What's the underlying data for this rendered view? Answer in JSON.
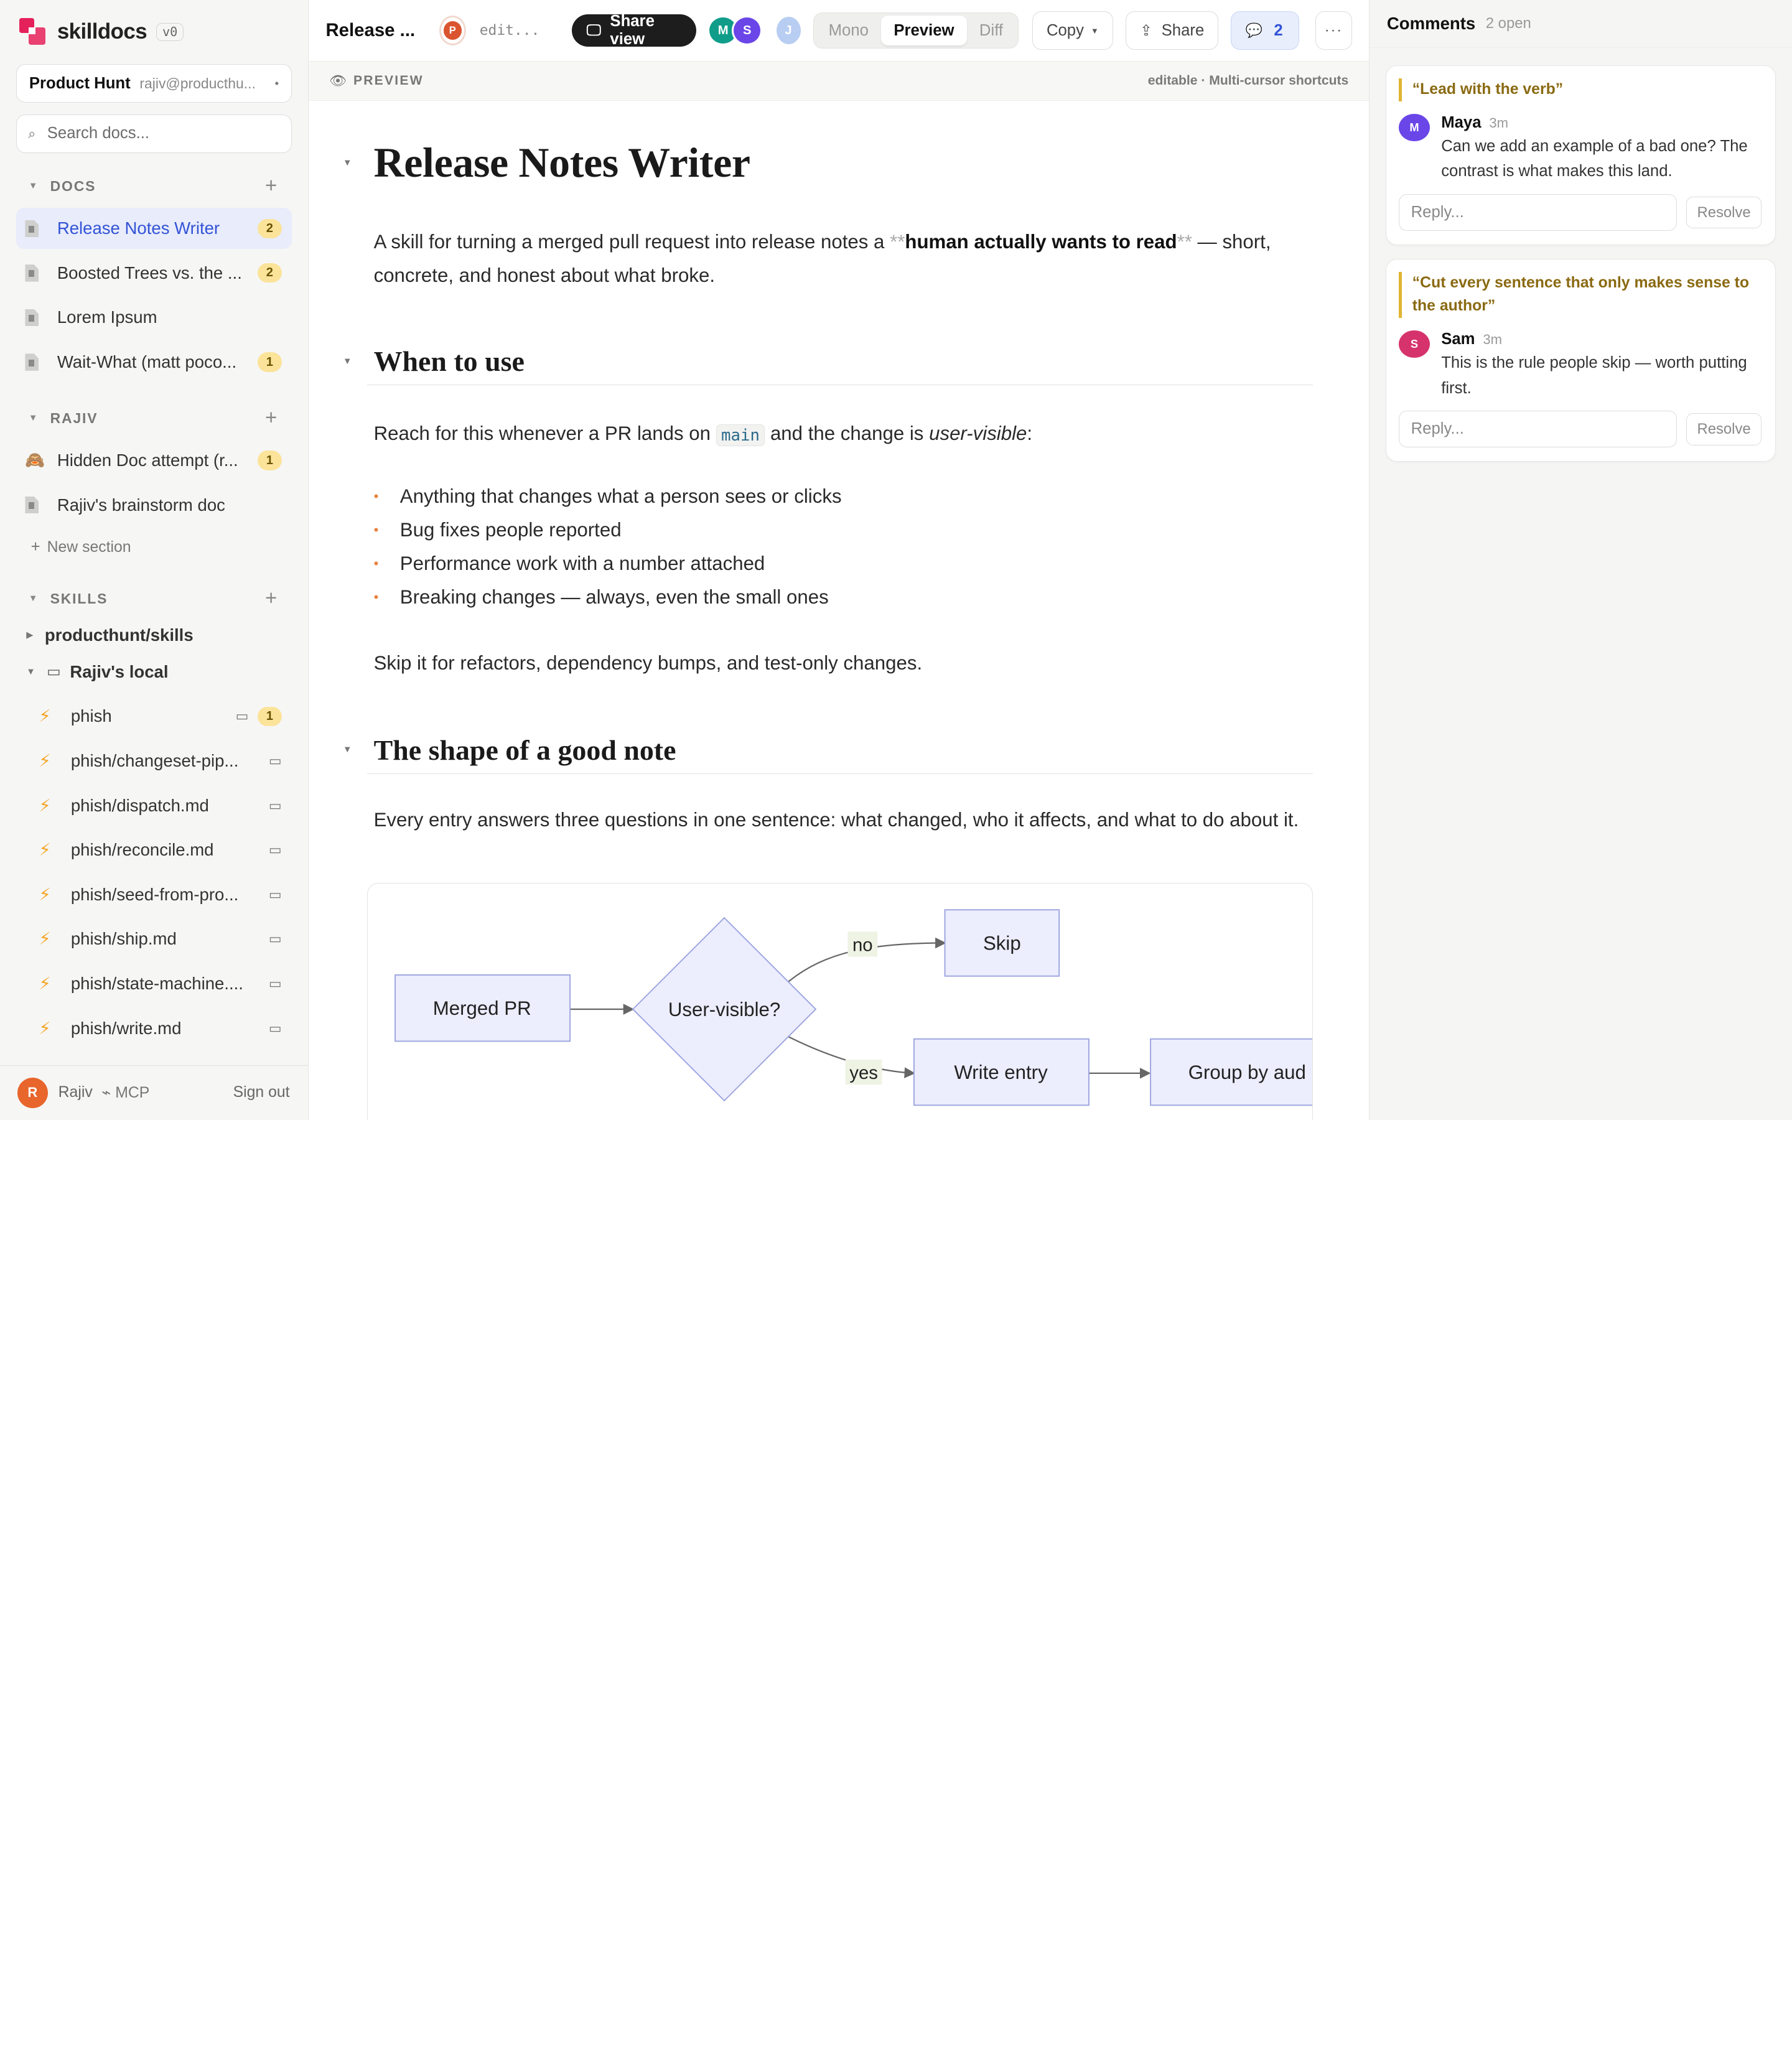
{
  "app": {
    "name": "skilldocs",
    "version": "v0"
  },
  "workspace": {
    "name": "Product Hunt",
    "email": "rajiv@producthu...",
    "menu_glyph": "•"
  },
  "search": {
    "placeholder": "Search docs..."
  },
  "sections": {
    "docs": {
      "label": "DOCS",
      "items": [
        {
          "label": "Release Notes Writer",
          "badge": "2",
          "active": true
        },
        {
          "label": "Boosted Trees vs. the ...",
          "badge": "2"
        },
        {
          "label": "Lorem Ipsum",
          "badge": ""
        },
        {
          "label": "Wait-What (matt poco...",
          "badge": "1"
        }
      ]
    },
    "rajiv": {
      "label": "RAJIV",
      "items": [
        {
          "label": "Hidden Doc attempt (r...",
          "badge": "1",
          "icon": "🙈"
        },
        {
          "label": "Rajiv's brainstorm doc",
          "badge": ""
        }
      ]
    },
    "new_section": "New section",
    "skills": {
      "label": "SKILLS",
      "group1": "producthunt/skills",
      "group2": "Rajiv's local",
      "items": [
        {
          "label": "phish",
          "badge": "1"
        },
        {
          "label": "phish/changeset-pip..."
        },
        {
          "label": "phish/dispatch.md"
        },
        {
          "label": "phish/reconcile.md"
        },
        {
          "label": "phish/seed-from-pro..."
        },
        {
          "label": "phish/ship.md"
        },
        {
          "label": "phish/state-machine...."
        },
        {
          "label": "phish/write.md"
        }
      ]
    }
  },
  "footer": {
    "user": "Rajiv",
    "user_initial": "R",
    "mcp": "⌁ MCP",
    "sign_out": "Sign out"
  },
  "toolbar": {
    "title": "Release ...",
    "editor_initial": "P",
    "editing": "edit...",
    "share_view": "Share view",
    "avatars": [
      {
        "initial": "M",
        "color": "#0f9d8a"
      },
      {
        "initial": "S",
        "color": "#6a46e8"
      }
    ],
    "avatar_j": "J",
    "modes": [
      "Mono",
      "Preview",
      "Diff"
    ],
    "active_mode": "Preview",
    "copy": "Copy",
    "share": "Share",
    "comments_count": "2",
    "more": "···"
  },
  "preview_bar": {
    "label": "PREVIEW",
    "right": "editable · Multi-cursor shortcuts"
  },
  "doc": {
    "title": "Release Notes Writer",
    "intro_pre": "A skill for turning a merged pull request into release notes a ",
    "intro_md": "**",
    "intro_bold": "human actually wants to read",
    "intro_post": " — short, concrete, and honest about what broke.",
    "h_when": "When to use",
    "when_pre": "Reach for this whenever a PR lands on ",
    "when_code": "main",
    "when_mid": " and the change is ",
    "when_em": "user-visible",
    "when_post": ":",
    "bullets": [
      "Anything that changes what a person sees or clicks",
      "Bug fixes people reported",
      "Performance work with a number attached",
      "Breaking changes — always, even the small ones"
    ],
    "skip": "Skip it for refactors, dependency bumps, and test-only changes.",
    "h_shape": "The shape of a good note",
    "shape_para": "Every entry answers three questions in one sentence: what changed, who it affects, and what to do about it.",
    "flow": {
      "merged": "Merged PR",
      "decision": "User-visible?",
      "no": "no",
      "yes": "yes",
      "skip": "Skip",
      "write": "Write entry",
      "group": "Group by aud"
    }
  },
  "comments": {
    "title": "Comments",
    "open": "2 open",
    "threads": [
      {
        "quote": "“Lead with the verb”",
        "author": "Maya",
        "initial": "M",
        "color": "#6a46e8",
        "time": "3m",
        "text": "Can we add an example of a bad one? The contrast is what makes this land.",
        "reply": "Reply...",
        "resolve": "Resolve"
      },
      {
        "quote": "“Cut every sentence that only makes sense to the author”",
        "author": "Sam",
        "initial": "S",
        "color": "#d6336c",
        "time": "3m",
        "text": "This is the rule people skip — worth putting first.",
        "reply": "Reply...",
        "resolve": "Resolve"
      }
    ]
  }
}
